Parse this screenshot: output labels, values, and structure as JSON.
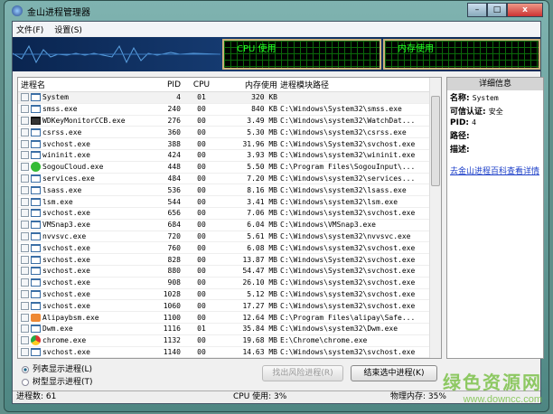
{
  "window": {
    "title": "金山进程管理器",
    "minimize": "–",
    "maximize": "□",
    "close": "x"
  },
  "menu": [
    "文件(F)",
    "设置(S)"
  ],
  "monitors": {
    "cpu": "CPU 使用",
    "mem": "内存使用"
  },
  "columns": {
    "name": "进程名",
    "pid": "PID",
    "cpu": "CPU",
    "mem": "内存使用",
    "path": "进程模块路径"
  },
  "rows": [
    {
      "name": "System",
      "pid": "4",
      "cpu": "01",
      "mem": "320 KB",
      "path": "",
      "icon": "window"
    },
    {
      "name": "smss.exe",
      "pid": "240",
      "cpu": "00",
      "mem": "840 KB",
      "path": "C:\\Windows\\System32\\smss.exe",
      "icon": "window"
    },
    {
      "name": "WDKeyMonitorCCB.exe",
      "pid": "276",
      "cpu": "00",
      "mem": "3.49 MB",
      "path": "C:\\Windows\\system32\\WatchDat...",
      "icon": "keyboard"
    },
    {
      "name": "csrss.exe",
      "pid": "360",
      "cpu": "00",
      "mem": "5.30 MB",
      "path": "C:\\Windows\\system32\\csrss.exe",
      "icon": "window"
    },
    {
      "name": "svchost.exe",
      "pid": "388",
      "cpu": "00",
      "mem": "31.96 MB",
      "path": "C:\\Windows\\System32\\svchost.exe",
      "icon": "window"
    },
    {
      "name": "wininit.exe",
      "pid": "424",
      "cpu": "00",
      "mem": "3.93 MB",
      "path": "C:\\Windows\\system32\\wininit.exe",
      "icon": "window"
    },
    {
      "name": "SogouCloud.exe",
      "pid": "448",
      "cpu": "00",
      "mem": "5.50 MB",
      "path": "C:\\Program Files\\SogouInput\\...",
      "icon": "sogou"
    },
    {
      "name": "services.exe",
      "pid": "484",
      "cpu": "00",
      "mem": "7.20 MB",
      "path": "C:\\Windows\\system32\\services...",
      "icon": "window"
    },
    {
      "name": "lsass.exe",
      "pid": "536",
      "cpu": "00",
      "mem": "8.16 MB",
      "path": "C:\\Windows\\system32\\lsass.exe",
      "icon": "window"
    },
    {
      "name": "lsm.exe",
      "pid": "544",
      "cpu": "00",
      "mem": "3.41 MB",
      "path": "C:\\Windows\\system32\\lsm.exe",
      "icon": "window"
    },
    {
      "name": "svchost.exe",
      "pid": "656",
      "cpu": "00",
      "mem": "7.06 MB",
      "path": "C:\\Windows\\system32\\svchost.exe",
      "icon": "window"
    },
    {
      "name": "VMSnap3.exe",
      "pid": "684",
      "cpu": "00",
      "mem": "6.04 MB",
      "path": "C:\\Windows\\VMSnap3.exe",
      "icon": "window"
    },
    {
      "name": "nvvsvc.exe",
      "pid": "720",
      "cpu": "00",
      "mem": "5.61 MB",
      "path": "C:\\Windows\\system32\\nvvsvc.exe",
      "icon": "window"
    },
    {
      "name": "svchost.exe",
      "pid": "760",
      "cpu": "00",
      "mem": "6.08 MB",
      "path": "C:\\Windows\\system32\\svchost.exe",
      "icon": "window"
    },
    {
      "name": "svchost.exe",
      "pid": "828",
      "cpu": "00",
      "mem": "13.87 MB",
      "path": "C:\\Windows\\System32\\svchost.exe",
      "icon": "window"
    },
    {
      "name": "svchost.exe",
      "pid": "880",
      "cpu": "00",
      "mem": "54.47 MB",
      "path": "C:\\Windows\\System32\\svchost.exe",
      "icon": "window"
    },
    {
      "name": "svchost.exe",
      "pid": "908",
      "cpu": "00",
      "mem": "26.10 MB",
      "path": "C:\\Windows\\system32\\svchost.exe",
      "icon": "window"
    },
    {
      "name": "svchost.exe",
      "pid": "1028",
      "cpu": "00",
      "mem": "5.12 MB",
      "path": "C:\\Windows\\system32\\svchost.exe",
      "icon": "window"
    },
    {
      "name": "svchost.exe",
      "pid": "1060",
      "cpu": "00",
      "mem": "17.27 MB",
      "path": "C:\\Windows\\system32\\svchost.exe",
      "icon": "window"
    },
    {
      "name": "Alipaybsm.exe",
      "pid": "1100",
      "cpu": "00",
      "mem": "12.64 MB",
      "path": "C:\\Program Files\\alipay\\Safe...",
      "icon": "alipay"
    },
    {
      "name": "Dwm.exe",
      "pid": "1116",
      "cpu": "01",
      "mem": "35.84 MB",
      "path": "C:\\Windows\\system32\\Dwm.exe",
      "icon": "window"
    },
    {
      "name": "chrome.exe",
      "pid": "1132",
      "cpu": "00",
      "mem": "19.68 MB",
      "path": "E:\\Chrome\\chrome.exe",
      "icon": "chrome"
    },
    {
      "name": "svchost.exe",
      "pid": "1140",
      "cpu": "00",
      "mem": "14.63 MB",
      "path": "C:\\Windows\\system32\\svchost.exe",
      "icon": "window"
    }
  ],
  "details": {
    "title": "详细信息",
    "name_label": "名称:",
    "name": "System",
    "trust_label": "可信认证:",
    "trust": "安全",
    "pid_label": "PID:",
    "pid": "4",
    "path_label": "路径:",
    "desc_label": "描述:",
    "link": "去金山进程百科查看详情"
  },
  "view": {
    "list": "列表显示进程(L)",
    "tree": "树型显示进程(T)",
    "selected": "list"
  },
  "buttons": {
    "find_risk": "找出风险进程(R)",
    "end": "结束选中进程(K)"
  },
  "status": {
    "count": "进程数: 61",
    "cpu": "CPU 使用: 3%",
    "mem": "物理内存: 35%"
  },
  "watermark": {
    "title": "绿色资源网",
    "url": "www.downcc.com"
  }
}
